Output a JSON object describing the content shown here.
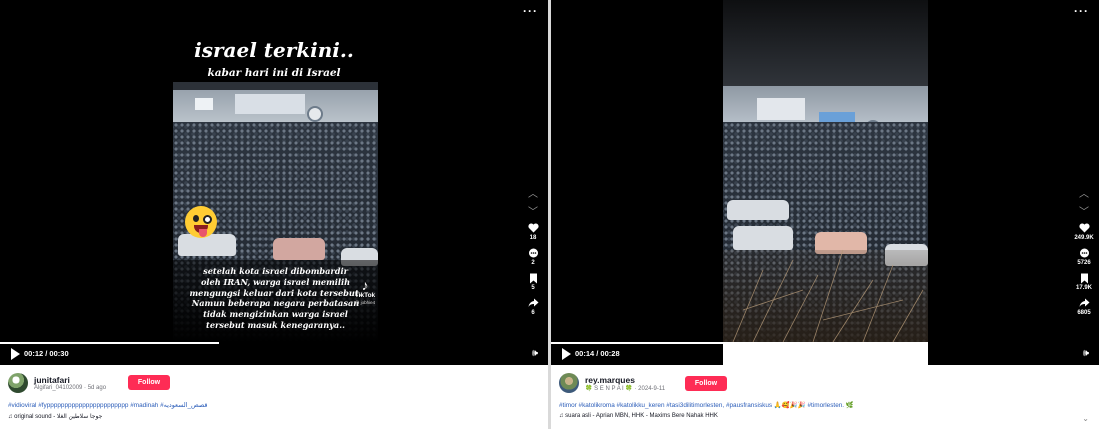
{
  "left": {
    "overlay": {
      "title": "israel terkini..",
      "subtitle": "kabar hari ini di Israel",
      "caption_lines": [
        "setelah kota israel dibombardir",
        "oleh IRAN, warga israel memilih",
        "mengungsi keluar dari kota tersebut.",
        "Namun beberapa negara perbatasan",
        "tidak mengizinkan warga israel",
        "tersebut masuk kenegaranya.."
      ],
      "watermark": "TikTok",
      "watermark_handle": "@ jobhie4"
    },
    "more_label": "···",
    "actions": {
      "likes": "18",
      "comments": "2",
      "saves": "5",
      "shares": "6"
    },
    "player": {
      "time": "00:12 / 00:30",
      "progress": 0.4
    },
    "author": {
      "username": "junitafari",
      "sub": "Algifari_04102009 · 5d ago"
    },
    "follow_label": "Follow",
    "hashtags": "#vidioviral #fyppppppppppppppppppppppp #madinah #قصص_السعوديه",
    "sound": "original sound - جوجا سلاطين الغلا"
  },
  "right": {
    "more_label": "···",
    "actions": {
      "likes": "249.9K",
      "comments": "5726",
      "saves": "17.9K",
      "shares": "6805"
    },
    "player": {
      "time": "00:14 / 00:28",
      "progress": 0.5
    },
    "author": {
      "username": "rey.marques",
      "sub": "🍀 S E N P A I 🍀 · 2024-9-11"
    },
    "follow_label": "Follow",
    "hashtags": "#timor #katolikroma #katolikku_keren #tasi3dilitimorlesten, #pausfransiskus 🙏🥰🎉🎉 #timorlesten. 🌿",
    "sound": "suara asli - Aprian MBN, HHK - Maxims Bere Nahak HHK"
  },
  "colors": {
    "follow": "#fe2c55",
    "hashtag": "#2b5db9",
    "player_bg": "#000000"
  }
}
